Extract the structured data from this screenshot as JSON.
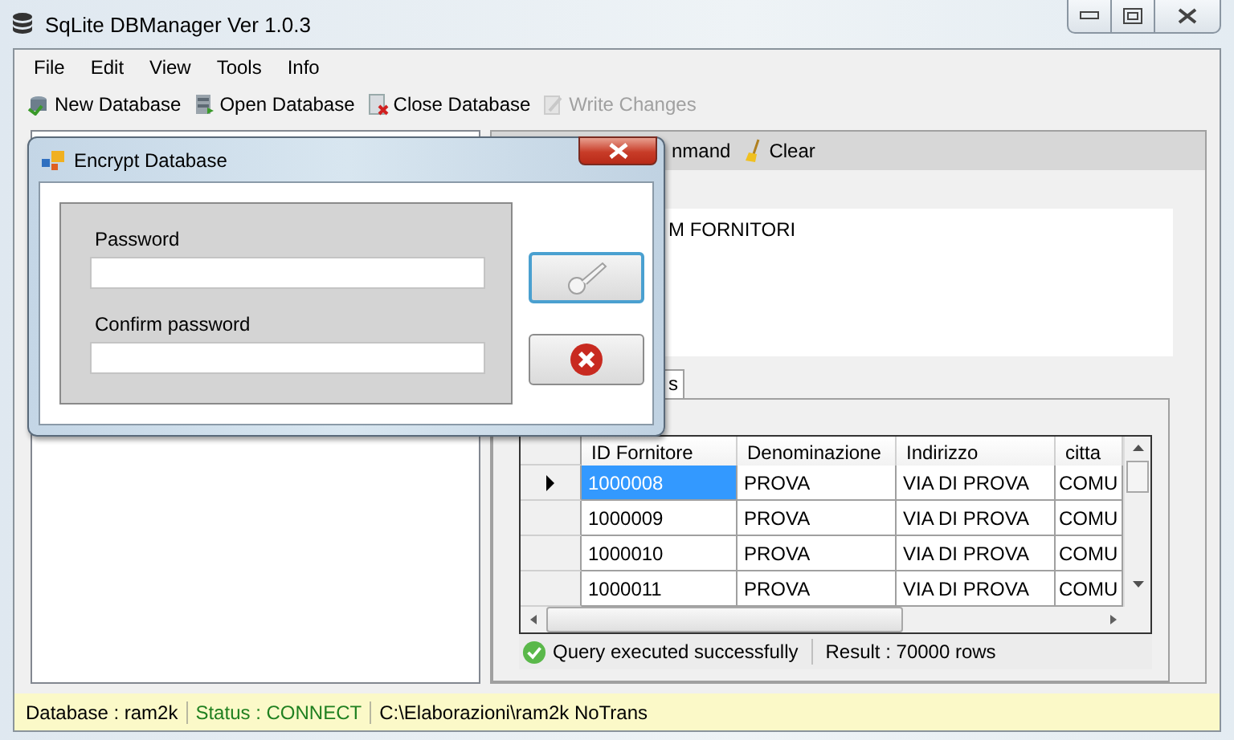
{
  "window": {
    "title": "SqLite DBManager Ver 1.0.3"
  },
  "menu": [
    "File",
    "Edit",
    "View",
    "Tools",
    "Info"
  ],
  "toolbar": [
    {
      "label": "New Database",
      "kind": "new",
      "disabled": false
    },
    {
      "label": "Open Database",
      "kind": "open",
      "disabled": false
    },
    {
      "label": "Close Database",
      "kind": "close",
      "disabled": false
    },
    {
      "label": "Write Changes",
      "kind": "write",
      "disabled": true
    }
  ],
  "command_bar": [
    {
      "label": "nmand",
      "kind": "command"
    },
    {
      "label": "Clear",
      "kind": "clear"
    }
  ],
  "query_text": "M FORNITORI",
  "result_tab": {
    "label": "s"
  },
  "grid": {
    "columns": [
      "ID Fornitore",
      "Denominazione",
      "Indirizzo",
      "citta"
    ],
    "rows": [
      {
        "selected": true,
        "cells": [
          "1000008",
          "PROVA",
          "VIA DI PROVA",
          "COMU"
        ]
      },
      {
        "selected": false,
        "cells": [
          "1000009",
          "PROVA",
          "VIA DI PROVA",
          "COMU"
        ]
      },
      {
        "selected": false,
        "cells": [
          "1000010",
          "PROVA",
          "VIA DI PROVA",
          "COMU"
        ]
      },
      {
        "selected": false,
        "cells": [
          "1000011",
          "PROVA",
          "VIA DI PROVA",
          "COMU"
        ]
      }
    ]
  },
  "grid_status": {
    "message": "Query executed successfully",
    "result": "Result : 70000 rows"
  },
  "status_bar": [
    {
      "text": "Database : ram2k",
      "kind": "normal"
    },
    {
      "text": "Status : CONNECT",
      "kind": "ok"
    },
    {
      "text": "C:\\Elaborazioni\\ram2k  NoTrans",
      "kind": "normal"
    }
  ],
  "dialog": {
    "title": "Encrypt Database",
    "fields": [
      {
        "label": "Password"
      },
      {
        "label": "Confirm password"
      }
    ]
  }
}
